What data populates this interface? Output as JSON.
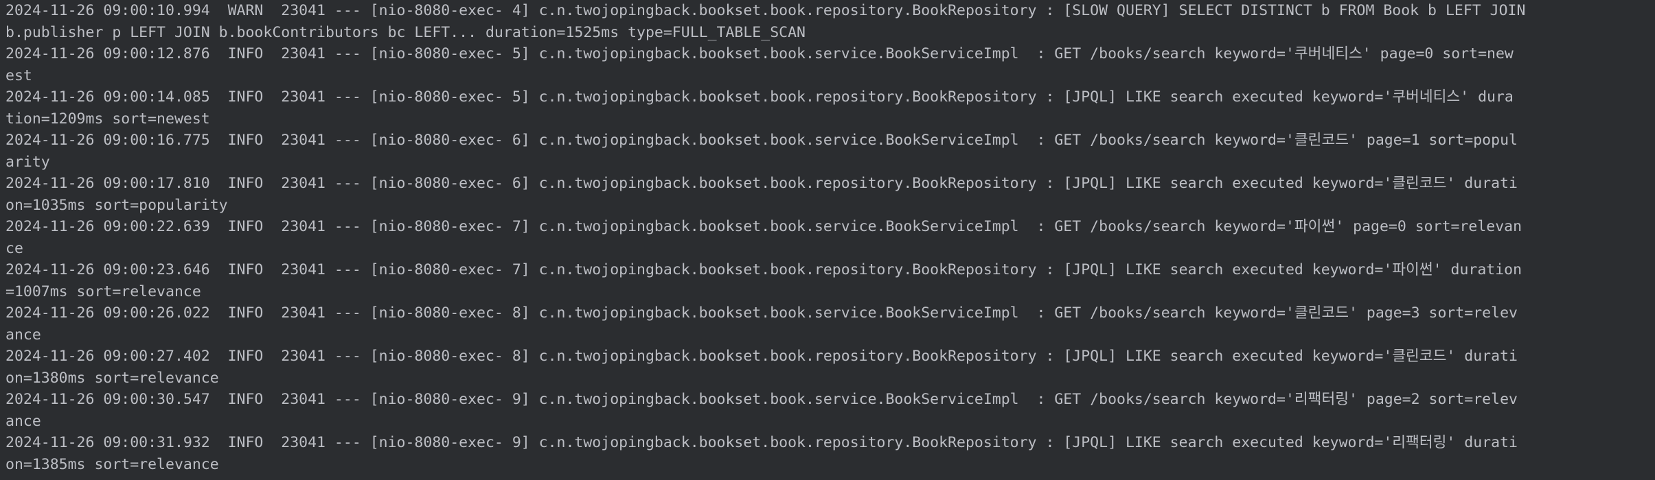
{
  "console": {
    "lines": [
      "2024-11-26 09:00:10.994  WARN  23041 --- [nio-8080-exec- 4] c.n.twojopingback.bookset.book.repository.BookRepository : [SLOW QUERY] SELECT DISTINCT b FROM Book b LEFT JOIN",
      "b.publisher p LEFT JOIN b.bookContributors bc LEFT... duration=1525ms type=FULL_TABLE_SCAN",
      "2024-11-26 09:00:12.876  INFO  23041 --- [nio-8080-exec- 5] c.n.twojopingback.bookset.book.service.BookServiceImpl  : GET /books/search keyword='쿠버네티스' page=0 sort=new",
      "est",
      "2024-11-26 09:00:14.085  INFO  23041 --- [nio-8080-exec- 5] c.n.twojopingback.bookset.book.repository.BookRepository : [JPQL] LIKE search executed keyword='쿠버네티스' dura",
      "tion=1209ms sort=newest",
      "2024-11-26 09:00:16.775  INFO  23041 --- [nio-8080-exec- 6] c.n.twojopingback.bookset.book.service.BookServiceImpl  : GET /books/search keyword='클린코드' page=1 sort=popul",
      "arity",
      "2024-11-26 09:00:17.810  INFO  23041 --- [nio-8080-exec- 6] c.n.twojopingback.bookset.book.repository.BookRepository : [JPQL] LIKE search executed keyword='클린코드' durati",
      "on=1035ms sort=popularity",
      "2024-11-26 09:00:22.639  INFO  23041 --- [nio-8080-exec- 7] c.n.twojopingback.bookset.book.service.BookServiceImpl  : GET /books/search keyword='파이썬' page=0 sort=relevan",
      "ce",
      "2024-11-26 09:00:23.646  INFO  23041 --- [nio-8080-exec- 7] c.n.twojopingback.bookset.book.repository.BookRepository : [JPQL] LIKE search executed keyword='파이썬' duration",
      "=1007ms sort=relevance",
      "2024-11-26 09:00:26.022  INFO  23041 --- [nio-8080-exec- 8] c.n.twojopingback.bookset.book.service.BookServiceImpl  : GET /books/search keyword='클린코드' page=3 sort=relev",
      "ance",
      "2024-11-26 09:00:27.402  INFO  23041 --- [nio-8080-exec- 8] c.n.twojopingback.bookset.book.repository.BookRepository : [JPQL] LIKE search executed keyword='클린코드' durati",
      "on=1380ms sort=relevance",
      "2024-11-26 09:00:30.547  INFO  23041 --- [nio-8080-exec- 9] c.n.twojopingback.bookset.book.service.BookServiceImpl  : GET /books/search keyword='리팩터링' page=2 sort=relev",
      "ance",
      "2024-11-26 09:00:31.932  INFO  23041 --- [nio-8080-exec- 9] c.n.twojopingback.bookset.book.repository.BookRepository : [JPQL] LIKE search executed keyword='리팩터링' durati",
      "on=1385ms sort=relevance"
    ]
  }
}
